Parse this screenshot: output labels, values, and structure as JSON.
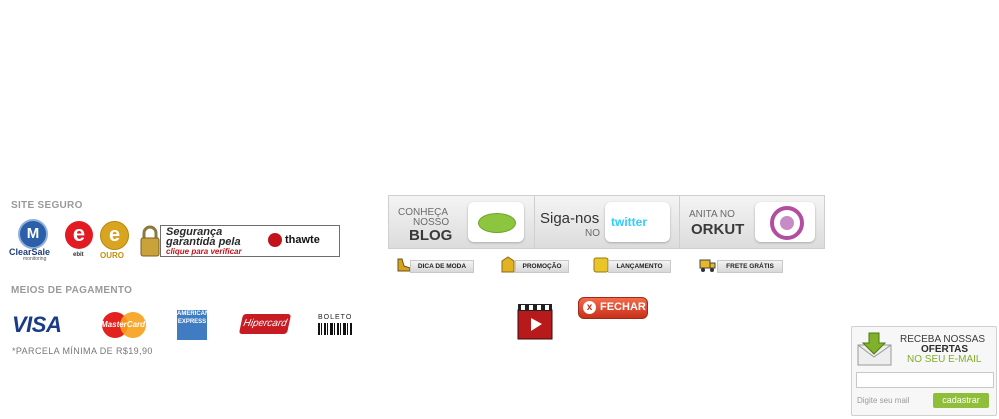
{
  "site_seguro": {
    "title": "SITE SEGURO",
    "clearsale": {
      "mark": "M",
      "name": "ClearSale",
      "sub": "monitoring"
    },
    "ebit": {
      "mark": "e",
      "name": "ebit"
    },
    "ouro": {
      "mark": "e",
      "name": "OURO"
    },
    "thawte": {
      "line1": "Segurança",
      "line2": "garantida pela",
      "link": "clique para verificar",
      "brand": "thawte"
    }
  },
  "pagamento": {
    "title": "MEIOS DE PAGAMENTO",
    "visa": "VISA",
    "mastercard": "MasterCard",
    "amex": "AMERICAN EXPRESS",
    "hipercard": "Hipercard",
    "boleto": "BOLETO",
    "parcela": "*PARCELA MÍNIMA DE R$19,90"
  },
  "social": {
    "blog": {
      "line1": "CONHEÇA",
      "line2": "NOSSO",
      "big": "BLOG"
    },
    "twitter": {
      "big": "Siga-nos",
      "small": "NO",
      "logo": "twitter"
    },
    "orkut": {
      "line1": "ANITA NO",
      "big": "ORKUT"
    }
  },
  "tags": [
    {
      "label": "DICA DE MODA",
      "icon": "shoe-icon"
    },
    {
      "label": "PROMOÇÃO",
      "icon": "price-tag-icon"
    },
    {
      "label": "LANÇAMENTO",
      "icon": "new-star-icon"
    },
    {
      "label": "FRETE GRÁTIS",
      "icon": "truck-icon"
    }
  ],
  "fechar": {
    "label": "FECHAR",
    "x": "x"
  },
  "newsletter": {
    "line1": "RECEBA NOSSAS",
    "line2": "OFERTAS",
    "line3": "NO SEU E-MAIL",
    "hint": "Digite seu mail",
    "button": "cadastrar",
    "input_value": ""
  },
  "colors": {
    "accent_green": "#8fbf3a",
    "close_red": "#d83a1f",
    "visa_blue": "#1a3a8a"
  }
}
